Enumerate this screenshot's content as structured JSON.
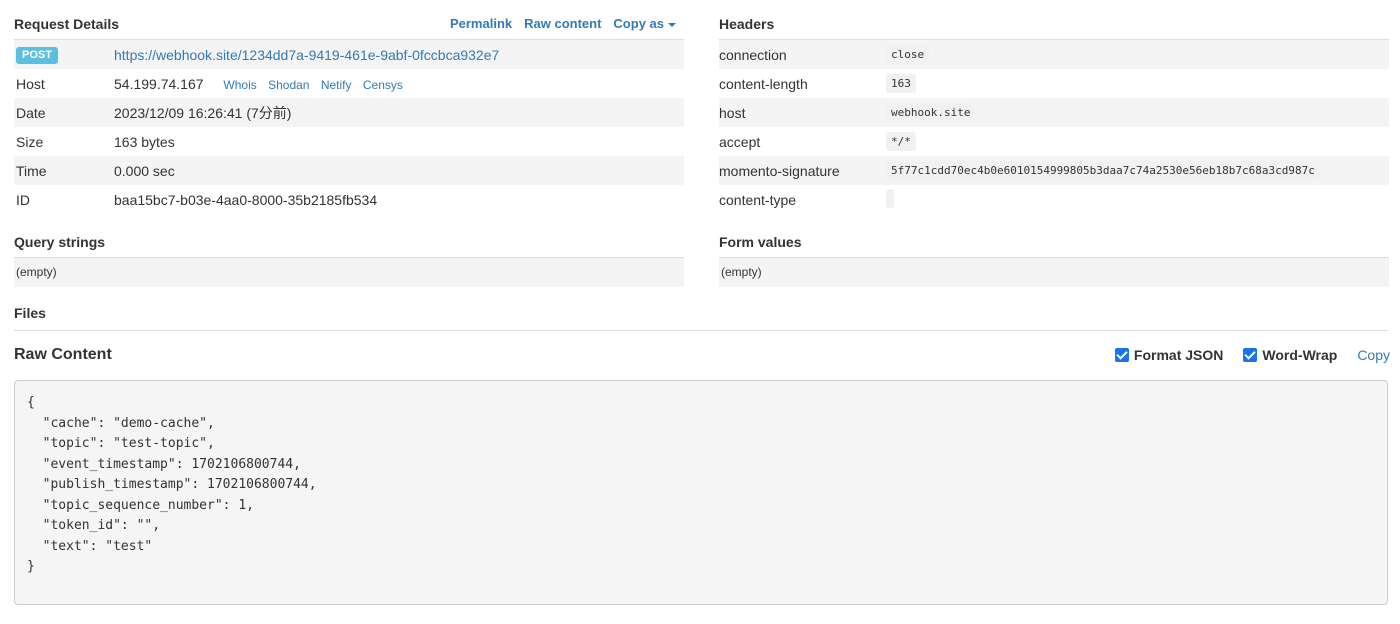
{
  "request_details": {
    "title": "Request Details",
    "links": {
      "permalink": "Permalink",
      "raw_content": "Raw content",
      "copy_as": "Copy as"
    },
    "method": "POST",
    "url": "https://webhook.site/1234dd7a-9419-461e-9abf-0fccbca932e7",
    "rows": [
      {
        "label": "Host",
        "value": "54.199.74.167"
      },
      {
        "label": "Date",
        "value": "2023/12/09 16:26:41 (7分前)"
      },
      {
        "label": "Size",
        "value": "163 bytes"
      },
      {
        "label": "Time",
        "value": "0.000 sec"
      },
      {
        "label": "ID",
        "value": "baa15bc7-b03e-4aa0-8000-35b2185fb534"
      }
    ],
    "host_links": [
      "Whois",
      "Shodan",
      "Netify",
      "Censys"
    ]
  },
  "headers": {
    "title": "Headers",
    "rows": [
      {
        "name": "connection",
        "value": "close"
      },
      {
        "name": "content-length",
        "value": "163"
      },
      {
        "name": "host",
        "value": "webhook.site"
      },
      {
        "name": "accept",
        "value": "*/*"
      },
      {
        "name": "momento-signature",
        "value": "5f77c1cdd70ec4b0e6010154999805b3daa7c74a2530e56eb18b7c68a3cd987c"
      },
      {
        "name": "content-type",
        "value": ""
      }
    ]
  },
  "query_strings": {
    "title": "Query strings",
    "empty": "(empty)"
  },
  "form_values": {
    "title": "Form values",
    "empty": "(empty)"
  },
  "files": {
    "title": "Files"
  },
  "raw_content": {
    "title": "Raw Content",
    "format_json": "Format JSON",
    "word_wrap": "Word-Wrap",
    "copy": "Copy",
    "body": "{\n  \"cache\": \"demo-cache\",\n  \"topic\": \"test-topic\",\n  \"event_timestamp\": 1702106800744,\n  \"publish_timestamp\": 1702106800744,\n  \"topic_sequence_number\": 1,\n  \"token_id\": \"\",\n  \"text\": \"test\"\n}"
  }
}
